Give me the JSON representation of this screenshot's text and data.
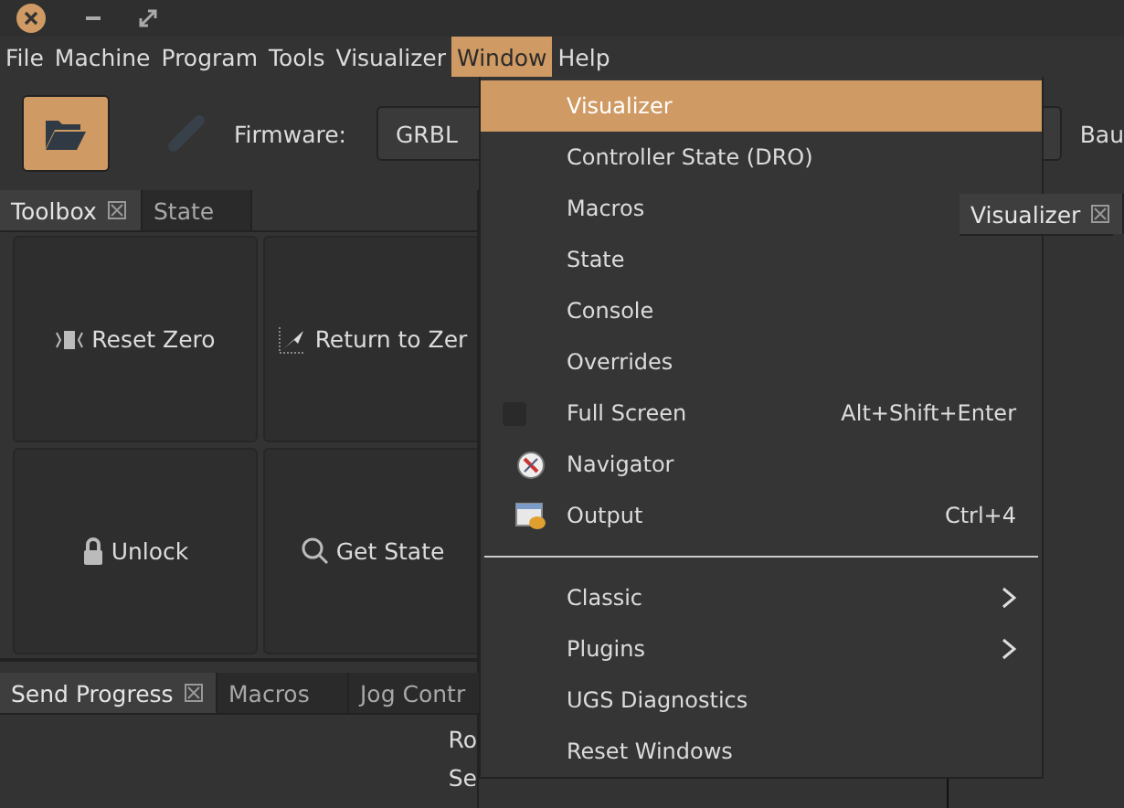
{
  "menubar": [
    {
      "label": "File",
      "selected": false
    },
    {
      "label": "Machine",
      "selected": false
    },
    {
      "label": "Program",
      "selected": false
    },
    {
      "label": "Tools",
      "selected": false
    },
    {
      "label": "Visualizer",
      "selected": false
    },
    {
      "label": "Window",
      "selected": true
    },
    {
      "label": "Help",
      "selected": false
    }
  ],
  "toolbar": {
    "firmware_label": "Firmware:",
    "firmware_value": "GRBL",
    "baud_label": "Bau"
  },
  "left_tabs": [
    {
      "label": "Toolbox",
      "closable": true,
      "selected": true
    },
    {
      "label": "State",
      "closable": false,
      "selected": false
    }
  ],
  "toolbox_buttons": [
    {
      "label": "Reset Zero",
      "kind": "zero"
    },
    {
      "label": "Return to Zer",
      "kind": "return"
    },
    {
      "label": "Unlock",
      "kind": "lock"
    },
    {
      "label": "Get State",
      "kind": "search"
    }
  ],
  "bottom_tabs": [
    {
      "label": "Send Progress",
      "closable": true,
      "selected": true
    },
    {
      "label": "Macros",
      "closable": false,
      "selected": false
    },
    {
      "label": "Jog Contr",
      "closable": false,
      "selected": false
    }
  ],
  "progress_labels": [
    "Ro",
    "Se"
  ],
  "right_tabs": [
    {
      "label": "Visualizer",
      "closable": true,
      "selected": true
    }
  ],
  "window_menu": [
    {
      "kind": "plain",
      "label": "Visualizer",
      "selected": true
    },
    {
      "kind": "plain",
      "label": "Controller State (DRO)",
      "selected": false
    },
    {
      "kind": "plain",
      "label": "Macros",
      "selected": false
    },
    {
      "kind": "plain",
      "label": "State",
      "selected": false
    },
    {
      "kind": "plain",
      "label": "Console",
      "selected": false
    },
    {
      "kind": "plain",
      "label": "Overrides",
      "selected": false
    },
    {
      "kind": "check",
      "label": "Full Screen",
      "shortcut": "Alt+Shift+Enter",
      "checked": false,
      "selected": false
    },
    {
      "kind": "compass",
      "label": "Navigator",
      "selected": false
    },
    {
      "kind": "output",
      "label": "Output",
      "shortcut": "Ctrl+4",
      "selected": false
    },
    {
      "kind": "separator"
    },
    {
      "kind": "submenu",
      "label": "Classic",
      "selected": false
    },
    {
      "kind": "submenu",
      "label": "Plugins",
      "selected": false
    },
    {
      "kind": "plain",
      "label": "UGS Diagnostics",
      "selected": false
    },
    {
      "kind": "plain",
      "label": "Reset Windows",
      "selected": false
    }
  ]
}
